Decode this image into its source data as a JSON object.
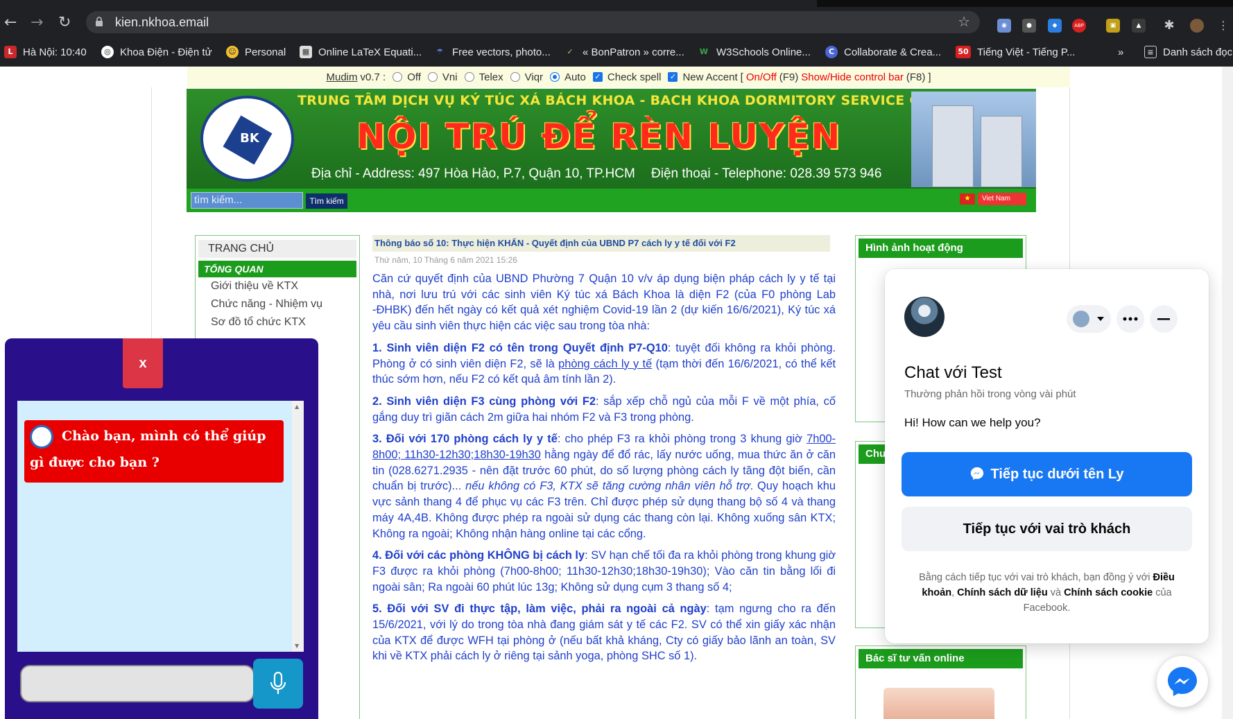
{
  "browser": {
    "url": "kien.nkhoa.email",
    "bookmarks": [
      {
        "label": "Hà Nội: 10:40",
        "icon": "L"
      },
      {
        "label": "Khoa Điện - Điện tử",
        "icon": "◎"
      },
      {
        "label": "Personal",
        "icon": "☺"
      },
      {
        "label": "Online LaTeX Equati...",
        "icon": "▦"
      },
      {
        "label": "Free vectors, photo...",
        "icon": "☂"
      },
      {
        "label": "« BonPatron » corre...",
        "icon": "✓"
      },
      {
        "label": "W3Schools Online...",
        "icon": "W"
      },
      {
        "label": "Collaborate & Crea...",
        "icon": "C"
      },
      {
        "label": "Tiếng Việt - Tiếng P...",
        "icon": "50"
      }
    ],
    "overflow": "»",
    "reading_list": "Danh sách đọc",
    "extensions": [
      "ABP"
    ]
  },
  "mudim": {
    "prefix": "Mudim",
    "version": "v0.7 :",
    "options": [
      "Off",
      "Vni",
      "Telex",
      "Viqr",
      "Auto"
    ],
    "check1": "Check spell",
    "check2": "New Accent",
    "bracket_open": "[",
    "onoff": "On/Off",
    "f9": "(F9)",
    "showhide": "Show/Hide control bar",
    "f8": "(F8)",
    "bracket_close": "]"
  },
  "banner": {
    "header": "TRUNG TÂM DỊCH VỤ KÝ TÚC XÁ BÁCH KHOA - BACH KHOA DORMITORY SERVICE CENTER",
    "main": "NỘI TRÚ ĐỂ RÈN LUYỆN",
    "address": "Địa chỉ - Address: 497 Hòa Hảo, P.7, Quận 10, TP.HCM",
    "phone": "Điện thoại - Telephone: 028.39 573 946",
    "logo_text": "BK"
  },
  "search": {
    "placeholder": "tìm kiếm...",
    "button": "Tìm kiếm",
    "lang": "Viet Nam"
  },
  "left_nav": {
    "home": "TRANG CHỦ",
    "section": "TỔNG QUAN",
    "items": [
      "Giới thiệu về KTX",
      "Chức năng - Nhiệm vụ",
      "Sơ đồ tổ chức KTX"
    ]
  },
  "article": {
    "title": "Thông báo số 10: Thực hiện KHẨN - Quyết định của UBND P7 cách ly y tế đối với F2",
    "date": "Thứ năm, 10 Tháng 6 năm 2021 15:26",
    "intro": "Căn cứ quyết định của UBND Phường 7 Quận 10 v/v áp dụng biện pháp cách ly y tế tại nhà, nơi lưu trú với các sinh viên Ký túc xá Bách Khoa là diện F2 (của F0 phòng Lab -ĐHBK) đến hết ngày có kết quả xét nghiệm Covid-19 lần 2 (dự kiến 16/6/2021), Ký túc xá yêu cầu sinh viên thực hiện các việc sau trong tòa nhà:",
    "p1_head": "1. Sinh viên diện F2 có tên trong Quyết định P7-Q10",
    "p1_a": ": tuyệt đối không ra khỏi phòng. Phòng ở có sinh viên diện F2, sẽ là ",
    "p1_u": "phòng cách ly y tế",
    "p1_b": " (tạm thời đến 16/6/2021, có thể kết thúc sớm hơn, nếu F2 có kết quả âm tính lần 2).",
    "p2_head": "2. Sinh viên diện F3 cùng phòng với F2",
    "p2_a": ": sắp xếp chỗ ngủ của mỗi F về một phía, cố gắng duy trì giãn cách 2m giữa hai nhóm F2 và F3 trong phòng.",
    "p3_head": "3. Đối với 170 phòng cách ly y tế",
    "p3_a": ": cho phép F3 ra khỏi phòng trong 3 khung giờ ",
    "p3_u": "7h00-8h00; 11h30-12h30;18h30-19h30",
    "p3_b": " hằng ngày để đổ rác, lấy nước uống, mua thức ăn ở căn tin (028.6271.2935 - nên đặt trước 60 phút, do số lượng phòng cách ly tăng đột biến, cần chuẩn bị trước)... ",
    "p3_i": "nếu không có F3, KTX sẽ tăng cường nhân viên hỗ trợ",
    "p3_c": ". Quy hoạch khu vực sảnh thang 4 để phục vụ các F3 trên. Chỉ được phép sử dụng thang bộ số 4 và thang máy 4A,4B. Không được phép ra ngoài sử dụng các thang còn lại. Không xuống sân KTX; Không ra ngoài; Không nhận hàng online tại các cổng.",
    "p4_head": "4. Đối với các phòng KHÔNG bị cách ly",
    "p4_a": ": SV hạn chế tối đa ra khỏi phòng trong khung giờ F3 được ra khỏi phòng (7h00-8h00; 11h30-12h30;18h30-19h30); Vào căn tin bằng lối đi ngoài sân; Ra ngoài 60 phút lúc 13g; Không sử dụng cụm 3 thang số 4;",
    "p5_head": "5. Đối với SV đi thực tập, làm việc, phải ra ngoài cả ngày",
    "p5_a": ": tạm ngưng cho ra đến 15/6/2021, với lý do trong tòa nhà đang giám sát y tế các F2. SV có thể xin giấy xác nhận của KTX để được WFH tại phòng ở (nếu bất khả kháng, Cty có giấy bảo lãnh an toàn, SV khi về KTX phải cách ly ở riêng tại sảnh yoga, phòng SHC số 1)."
  },
  "right_col": {
    "box1": "Hình ảnh hoạt động",
    "box2": "Chu",
    "box3": "Bác sĩ tư vấn online"
  },
  "chatbot": {
    "close": "x",
    "greeting": "Chào bạn, mình có thể giúp gì được cho bạn ?"
  },
  "messenger": {
    "title": "Chat với Test",
    "subtitle": "Thường phản hồi trong vòng vài phút",
    "greeting": "Hi! How can we help you?",
    "primary": "Tiếp tục dưới tên Ly",
    "secondary": "Tiếp tục với vai trò khách",
    "legal_a": "Bằng cách tiếp tục với vai trò khách, bạn đồng ý với ",
    "legal_terms": "Điều khoản",
    "legal_b": ", ",
    "legal_data": "Chính sách dữ liệu",
    "legal_c": " và ",
    "legal_cookie": "Chính sách cookie",
    "legal_d": " của Facebook."
  }
}
